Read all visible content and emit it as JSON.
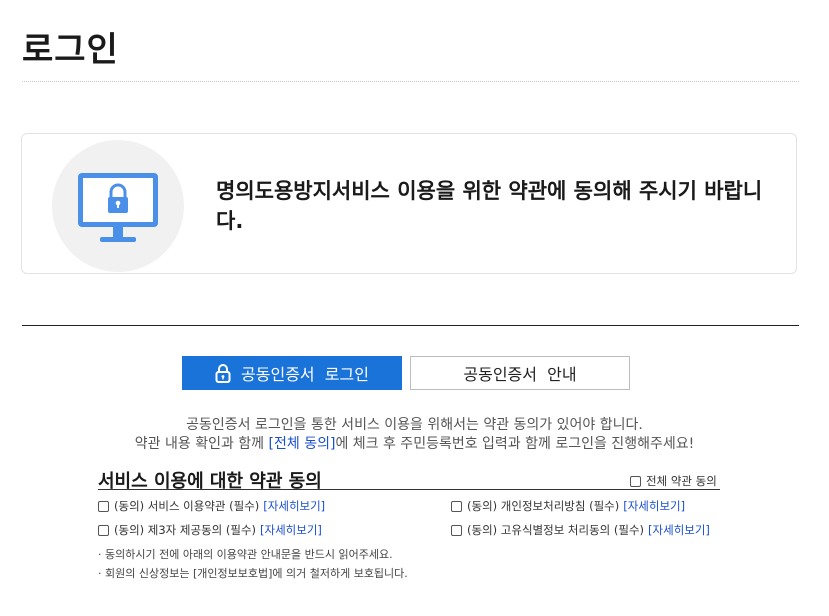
{
  "page": {
    "title": "로그인"
  },
  "notice": {
    "icon": "monitor-lock-icon",
    "text": "명의도용방지서비스 이용을 위한 약관에 동의해 주시기 바랍니다."
  },
  "tabs": {
    "login_label": "공동인증서  로그인",
    "login_icon": "lock-icon",
    "guide_label": "공동인증서  안내"
  },
  "intro": {
    "line1": "공동인증서 로그인을 통한 서비스 이용을 위해서는 약관 동의가 있어야 합니다.",
    "line2_before": "약관 내용 확인과 함께 ",
    "line2_link": "[전체 동의]",
    "line2_after": "에 체크 후 주민등록번호 입력과 함께 로그인을 진행해주세요!"
  },
  "terms": {
    "title": "서비스 이용에 대한 약관 동의",
    "all_label": "전체 약관 동의",
    "items": [
      {
        "label": "(동의) 서비스 이용약관 (필수)",
        "detail": "[자세히보기]"
      },
      {
        "label": "(동의) 개인정보처리방침 (필수)",
        "detail": "[자세히보기]"
      },
      {
        "label": "(동의) 제3자 제공동의 (필수)",
        "detail": "[자세히보기]"
      },
      {
        "label": "(동의) 고유식별정보 처리동의 (필수)",
        "detail": "[자세히보기]"
      }
    ],
    "notes": [
      "· 동의하시기 전에 아래의 이용약관 안내문을 반드시 읽어주세요.",
      "· 회원의 신상정보는 [개인정보보호법]에 의거 철저하게 보호됩니다."
    ]
  },
  "colors": {
    "accent": "#1a73d9",
    "icon_blue": "#4a8fe8",
    "link": "#1a4fcf"
  }
}
